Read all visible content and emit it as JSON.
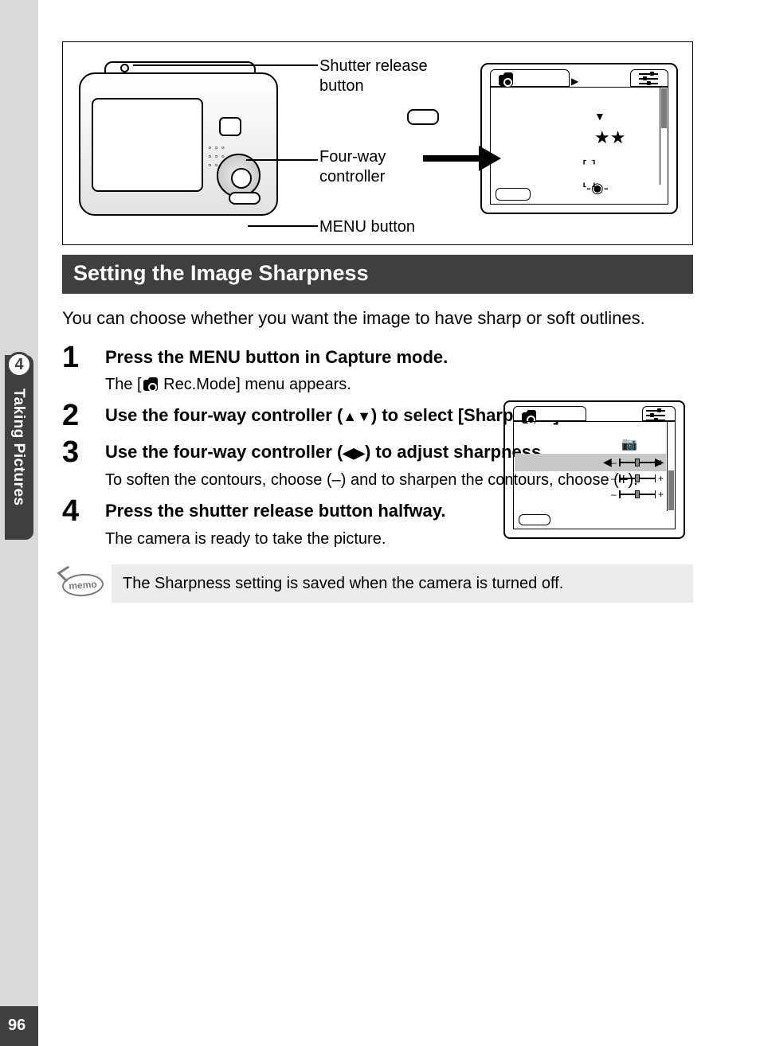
{
  "side_tab": {
    "chapter_num": "4",
    "chapter_title": "Taking Pictures"
  },
  "page_number": "96",
  "diagram": {
    "shutter_label": "Shutter release button",
    "fourway_label": "Four-way controller",
    "menu_label": "MENU button"
  },
  "section_heading": "Setting the Image Sharpness",
  "intro_text": "You can choose whether you want the image to have sharp or soft outlines.",
  "steps": {
    "s1": {
      "num": "1",
      "title": "Press the MENU button in Capture mode.",
      "desc_pre": "The [",
      "desc_post": " Rec.Mode] menu appears."
    },
    "s2": {
      "num": "2",
      "title_pre": "Use the four-way controller (",
      "title_arrows": "▲▼",
      "title_post": ") to select [Sharpness]."
    },
    "s3": {
      "num": "3",
      "title_pre": "Use the four-way controller (",
      "title_arrows": "◀▶",
      "title_post": ") to adjust sharpness.",
      "desc": "To soften the contours, choose (–) and to sharpen the contours, choose (+)."
    },
    "s4": {
      "num": "4",
      "title": "Press the shutter release button halfway.",
      "desc": "The camera is ready to take the picture."
    }
  },
  "memo": {
    "badge": "memo",
    "text": "The Sharpness setting is saved when the camera is turned off."
  },
  "lcd1": {
    "stars": "★★"
  }
}
